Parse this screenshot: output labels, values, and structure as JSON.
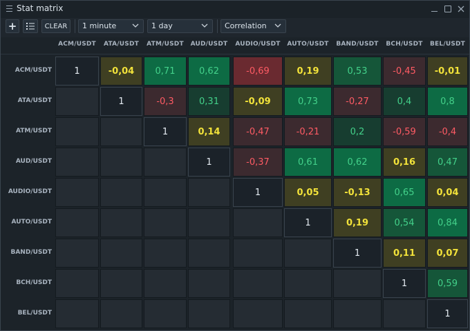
{
  "window": {
    "title": "Stat matrix"
  },
  "toolbar": {
    "add_label": "+",
    "clear_label": "CLEAR",
    "interval": "1 minute",
    "period": "1 day",
    "metric": "Correlation"
  },
  "colors": {
    "diag": "#1b2229",
    "empty": "#252c33",
    "green_strong": "#0d6b44",
    "green_med": "#155639",
    "green_dark": "#173d30",
    "yellow": "#3f3f22",
    "red_strong": "#6a2a30",
    "red_dark": "#3c2a2f",
    "text_green": "#43d18a",
    "text_yellow": "#f2e23a",
    "text_red": "#ff5b64",
    "text_diag": "#e6edf3"
  },
  "matrix": {
    "columns": [
      "ACM/USDT",
      "ATA/USDT",
      "ATM/USDT",
      "AUD/USDT",
      "AUDIO/USDT",
      "AUTO/USDT",
      "BAND/USDT",
      "BCH/USDT",
      "BEL/USDT"
    ],
    "rows": [
      "ACM/USDT",
      "ATA/USDT",
      "ATM/USDT",
      "AUD/USDT",
      "AUDIO/USDT",
      "AUTO/USDT",
      "BAND/USDT",
      "BCH/USDT",
      "BEL/USDT"
    ],
    "values": [
      [
        "1",
        "-0,04",
        "0,71",
        "0,62",
        "-0,69",
        "0,19",
        "0,53",
        "-0,45",
        "-0,01"
      ],
      [
        "",
        "1",
        "-0,3",
        "0,31",
        "-0,09",
        "0,73",
        "-0,27",
        "0,4",
        "0,8"
      ],
      [
        "",
        "",
        "1",
        "0,14",
        "-0,47",
        "-0,21",
        "0,2",
        "-0,59",
        "-0,4"
      ],
      [
        "",
        "",
        "",
        "1",
        "-0,37",
        "0,61",
        "0,62",
        "0,16",
        "0,47"
      ],
      [
        "",
        "",
        "",
        "",
        "1",
        "0,05",
        "-0,13",
        "0,65",
        "0,04"
      ],
      [
        "",
        "",
        "",
        "",
        "",
        "1",
        "0,19",
        "0,54",
        "0,84"
      ],
      [
        "",
        "",
        "",
        "",
        "",
        "",
        "1",
        "0,11",
        "0,07"
      ],
      [
        "",
        "",
        "",
        "",
        "",
        "",
        "",
        "1",
        "0,59"
      ],
      [
        "",
        "",
        "",
        "",
        "",
        "",
        "",
        "",
        "1"
      ]
    ]
  }
}
